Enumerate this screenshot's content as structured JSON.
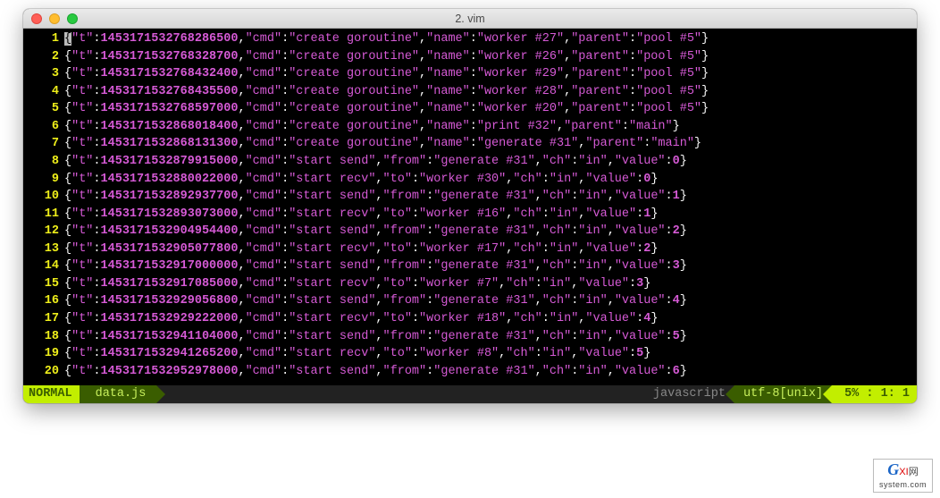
{
  "window": {
    "title": "2. vim"
  },
  "statusline": {
    "mode": "NORMAL",
    "filename": "data.js",
    "filetype": "javascript",
    "encoding": "utf-8[unix]",
    "percent": "5%",
    "line": "1",
    "col": "1"
  },
  "watermark": {
    "big": "G",
    "red": "XI",
    "small": "网",
    "sub": "system.com"
  },
  "lines": [
    {
      "n": 1,
      "obj": {
        "t": 1453171532768286484,
        "cmd": "create goroutine",
        "name": "worker #27",
        "parent": "pool #5"
      }
    },
    {
      "n": 2,
      "obj": {
        "t": 1453171532768328577,
        "cmd": "create goroutine",
        "name": "worker #26",
        "parent": "pool #5"
      }
    },
    {
      "n": 3,
      "obj": {
        "t": 1453171532768432492,
        "cmd": "create goroutine",
        "name": "worker #29",
        "parent": "pool #5"
      }
    },
    {
      "n": 4,
      "obj": {
        "t": 1453171532768435406,
        "cmd": "create goroutine",
        "name": "worker #28",
        "parent": "pool #5"
      }
    },
    {
      "n": 5,
      "obj": {
        "t": 1453171532768596996,
        "cmd": "create goroutine",
        "name": "worker #20",
        "parent": "pool #5"
      }
    },
    {
      "n": 6,
      "obj": {
        "t": 1453171532868018479,
        "cmd": "create goroutine",
        "name": "print #32",
        "parent": "main"
      }
    },
    {
      "n": 7,
      "obj": {
        "t": 1453171532868131248,
        "cmd": "create goroutine",
        "name": "generate #31",
        "parent": "main"
      }
    },
    {
      "n": 8,
      "obj": {
        "t": 1453171532879915073,
        "cmd": "start send",
        "from": "generate #31",
        "ch": "in",
        "value": 0
      }
    },
    {
      "n": 9,
      "obj": {
        "t": 1453171532880021908,
        "cmd": "start recv",
        "to": "worker #30",
        "ch": "in",
        "value": 0
      }
    },
    {
      "n": 10,
      "obj": {
        "t": 1453171532892937700,
        "cmd": "start send",
        "from": "generate #31",
        "ch": "in",
        "value": 1
      }
    },
    {
      "n": 11,
      "obj": {
        "t": 1453171532893072787,
        "cmd": "start recv",
        "to": "worker #16",
        "ch": "in",
        "value": 1
      }
    },
    {
      "n": 12,
      "obj": {
        "t": 1453171532904954369,
        "cmd": "start send",
        "from": "generate #31",
        "ch": "in",
        "value": 2
      }
    },
    {
      "n": 13,
      "obj": {
        "t": 1453171532905077725,
        "cmd": "start recv",
        "to": "worker #17",
        "ch": "in",
        "value": 2
      }
    },
    {
      "n": 14,
      "obj": {
        "t": 1453171532916999950,
        "cmd": "start send",
        "from": "generate #31",
        "ch": "in",
        "value": 3
      }
    },
    {
      "n": 15,
      "obj": {
        "t": 1453171532917084835,
        "cmd": "start recv",
        "to": "worker #7",
        "ch": "in",
        "value": 3
      }
    },
    {
      "n": 16,
      "obj": {
        "t": 1453171532929056797,
        "cmd": "start send",
        "from": "generate #31",
        "ch": "in",
        "value": 4
      }
    },
    {
      "n": 17,
      "obj": {
        "t": 1453171532929221817,
        "cmd": "start recv",
        "to": "worker #18",
        "ch": "in",
        "value": 4
      }
    },
    {
      "n": 18,
      "obj": {
        "t": 1453171532941104211,
        "cmd": "start send",
        "from": "generate #31",
        "ch": "in",
        "value": 5
      }
    },
    {
      "n": 19,
      "obj": {
        "t": 1453171532941265219,
        "cmd": "start recv",
        "to": "worker #8",
        "ch": "in",
        "value": 5
      }
    },
    {
      "n": 20,
      "obj": {
        "t": 1453171532952977981,
        "cmd": "start send",
        "from": "generate #31",
        "ch": "in",
        "value": 6
      }
    }
  ]
}
